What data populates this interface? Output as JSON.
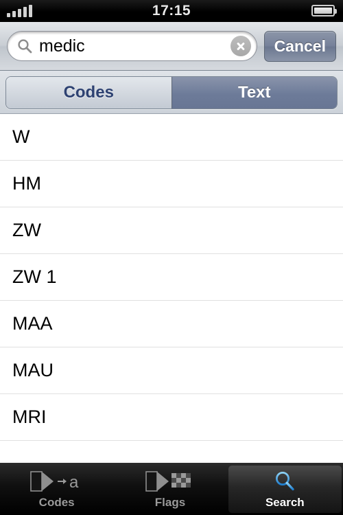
{
  "status_bar": {
    "signal_icon": "signal-bars-icon",
    "signal_bars": 5,
    "time": "17:15",
    "battery_icon": "battery-icon",
    "battery_level": 100
  },
  "search_bar": {
    "search_icon": "search-icon",
    "value": "medic",
    "placeholder": "Search",
    "clear_icon": "clear-circle-icon",
    "cancel_label": "Cancel"
  },
  "segmented_control": {
    "options": [
      {
        "label": "Codes",
        "selected": false
      },
      {
        "label": "Text",
        "selected": true
      }
    ],
    "selected_index": 1,
    "selected_bg": "#6d7b99",
    "unselected_text": "#2e4272"
  },
  "results": {
    "rows": [
      {
        "label": "W"
      },
      {
        "label": "HM"
      },
      {
        "label": "ZW"
      },
      {
        "label": "ZW 1"
      },
      {
        "label": "MAA"
      },
      {
        "label": "MAU"
      },
      {
        "label": "MRI"
      },
      {
        "label": ""
      }
    ]
  },
  "tab_bar": {
    "tabs": [
      {
        "label": "Codes",
        "icon": "flag-to-letter-icon",
        "active": false
      },
      {
        "label": "Flags",
        "icon": "flag-checkered-icon",
        "active": false
      },
      {
        "label": "Search",
        "icon": "search-icon",
        "active": true
      }
    ],
    "active_index": 2,
    "active_icon_color": "#3ea2e8"
  }
}
